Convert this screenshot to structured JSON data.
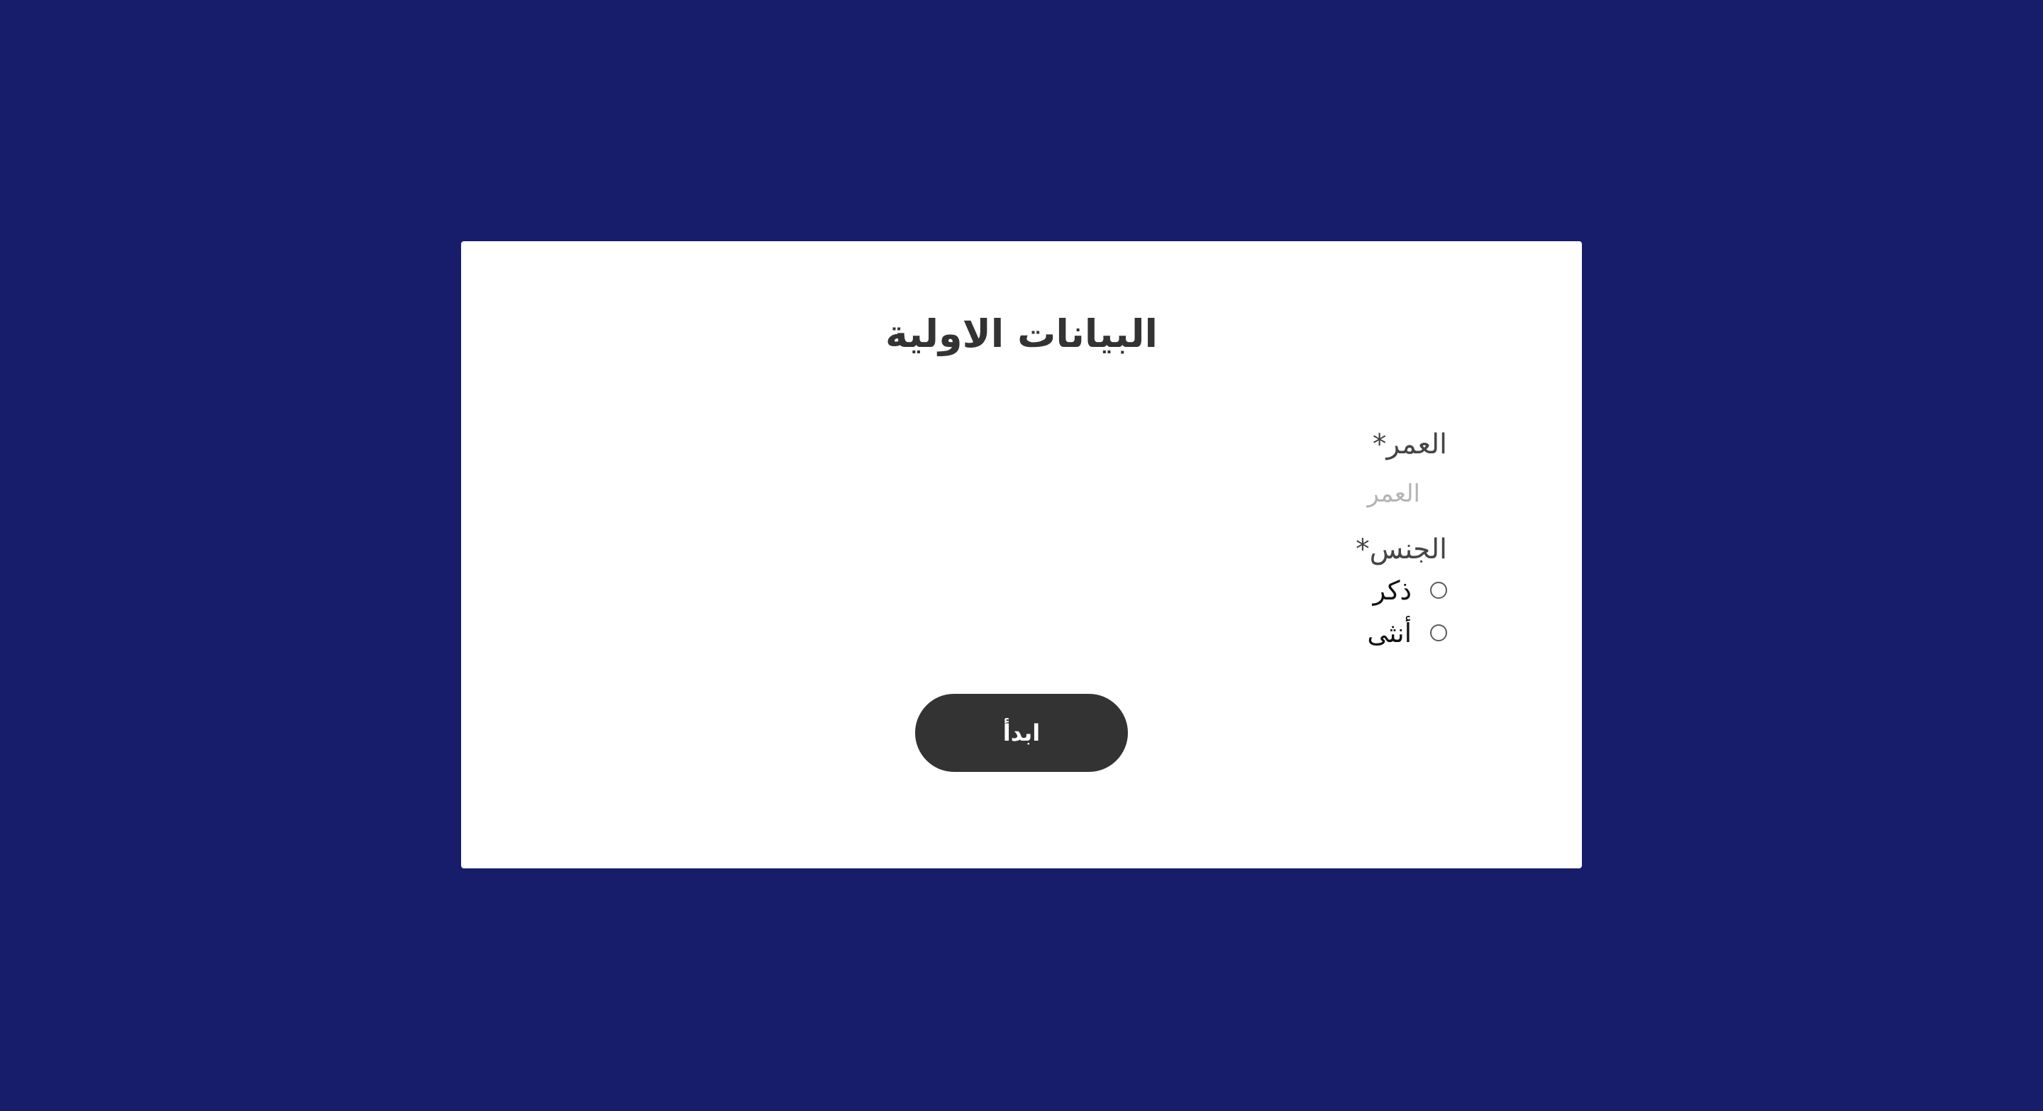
{
  "page": {
    "background_color": "#171c6b"
  },
  "card": {
    "title": "البيانات الاولية",
    "age_field": {
      "label": "العمر",
      "required_mark": "*",
      "placeholder": "العمر",
      "value": ""
    },
    "gender_field": {
      "label": "الجنس",
      "required_mark": "*",
      "options": [
        {
          "label": "ذكر",
          "selected": false
        },
        {
          "label": "أنثى",
          "selected": false
        }
      ]
    },
    "start_button_label": "ابدأ"
  }
}
